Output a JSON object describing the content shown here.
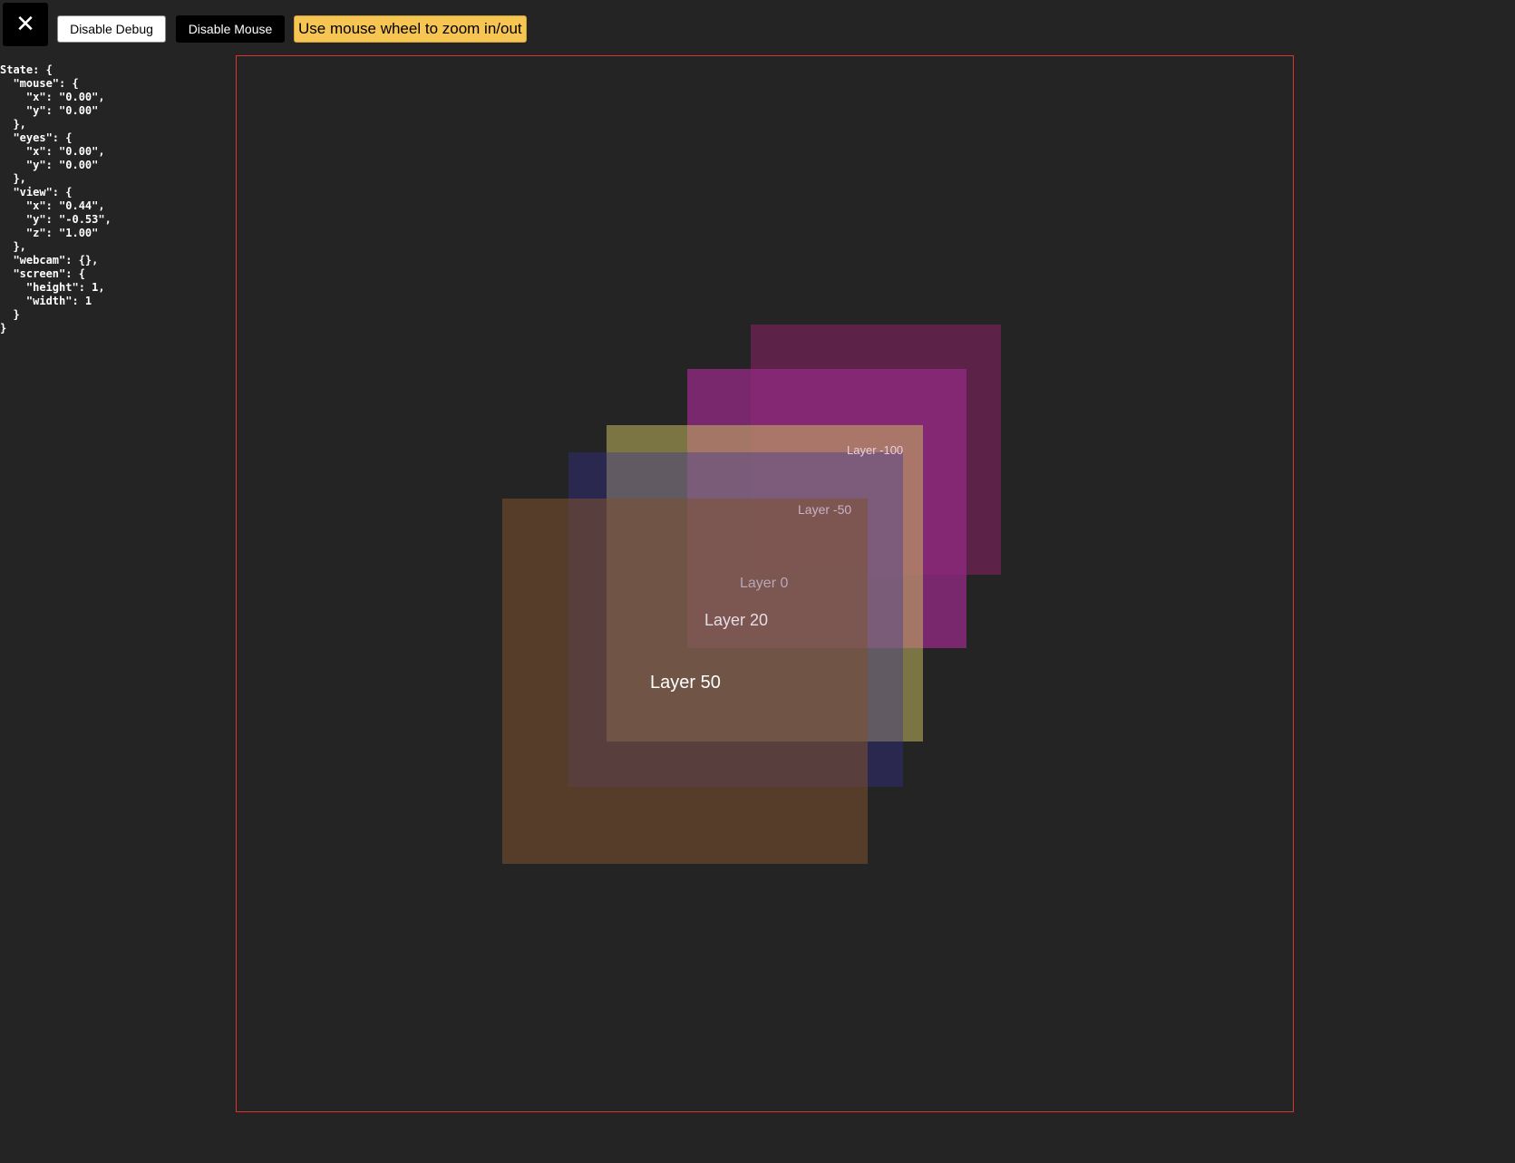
{
  "toolbar": {
    "close_glyph": "✕",
    "debug_button_label": "Disable Debug",
    "mouse_button_label": "Disable Mouse",
    "hint_text": "Use mouse wheel to zoom in/out"
  },
  "debug": {
    "state_text": "State: {\n  \"mouse\": {\n    \"x\": \"0.00\",\n    \"y\": \"0.00\"\n  },\n  \"eyes\": {\n    \"x\": \"0.00\",\n    \"y\": \"0.00\"\n  },\n  \"view\": {\n    \"x\": \"0.44\",\n    \"y\": \"-0.53\",\n    \"z\": \"1.00\"\n  },\n  \"webcam\": {},\n  \"screen\": {\n    \"height\": 1,\n    \"width\": 1\n  }\n}"
  },
  "layers": [
    {
      "label": "Layer -100",
      "color": "#5c2247",
      "label_color": "#e8cfe0"
    },
    {
      "label": "Layer -50",
      "color": "#8e2a7e",
      "label_color": "#c9b3c6"
    },
    {
      "label": "Layer 0",
      "color": "#7d7a38",
      "label_color": "#b8a7b8"
    },
    {
      "label": "Layer 20",
      "color": "#2c2866",
      "label_color": "#e7dde6"
    },
    {
      "label": "Layer 50",
      "color": "#533a2a",
      "label_color": "#ffffff"
    }
  ],
  "colors": {
    "viewport_border": "#e0312a",
    "hint_background": "#f7c652",
    "page_background": "#242424"
  }
}
